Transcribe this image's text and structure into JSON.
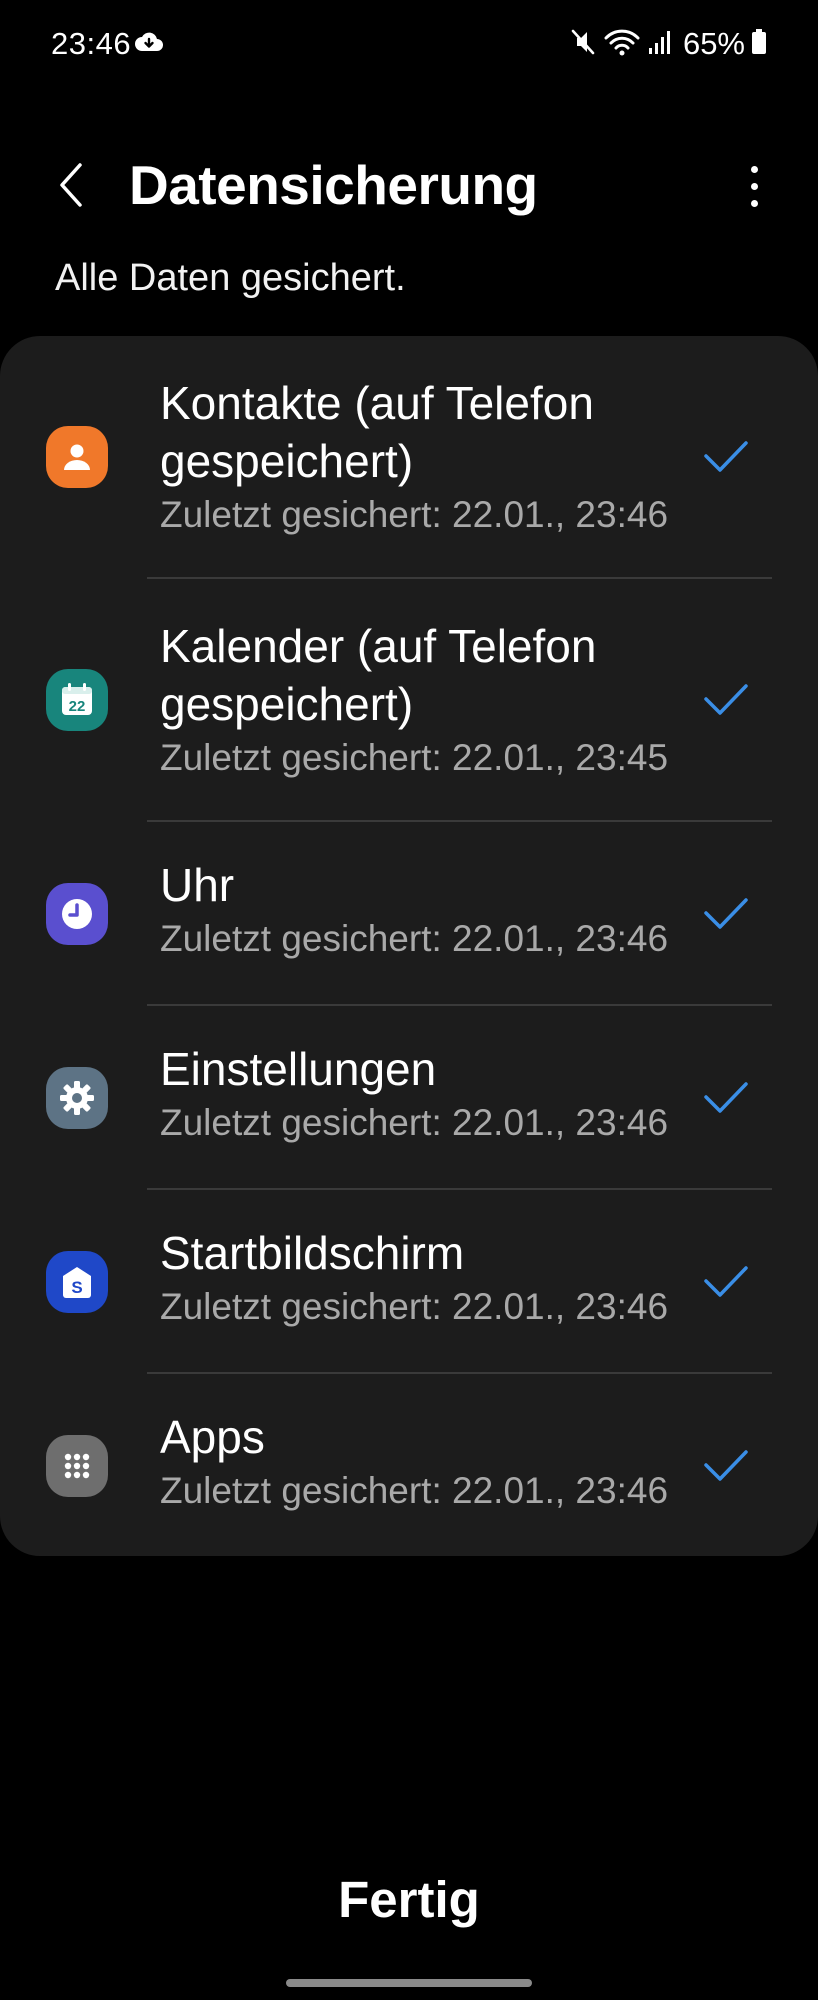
{
  "status_bar": {
    "time": "23:46",
    "battery": "65%",
    "icons": [
      "cloud-sync-icon",
      "mute-icon",
      "wifi-icon",
      "signal-icon",
      "battery-icon"
    ]
  },
  "header": {
    "title": "Datensicherung",
    "back_icon": "chevron-left-icon",
    "more_icon": "more-vertical-icon"
  },
  "subtitle": "Alle Daten gesichert.",
  "items": [
    {
      "title": "Kontakte (auf Telefon gespeichert)",
      "subtitle": "Zuletzt gesichert: 22.01., 23:46",
      "icon": "contacts-icon",
      "color": "#f0782a",
      "checked": true
    },
    {
      "title": "Kalender (auf Telefon gespeichert)",
      "subtitle": "Zuletzt gesichert: 22.01., 23:45",
      "icon": "calendar-icon",
      "icon_text": "22",
      "color": "#18857c",
      "checked": true
    },
    {
      "title": "Uhr",
      "subtitle": "Zuletzt gesichert: 22.01., 23:46",
      "icon": "clock-icon",
      "color": "#5a4fcf",
      "checked": true
    },
    {
      "title": "Einstellungen",
      "subtitle": "Zuletzt gesichert: 22.01., 23:46",
      "icon": "settings-gear-icon",
      "color": "#5d7385",
      "checked": true
    },
    {
      "title": "Startbildschirm",
      "subtitle": "Zuletzt gesichert: 22.01., 23:46",
      "icon": "home-screen-icon",
      "color": "#1f48c8",
      "checked": true
    },
    {
      "title": "Apps",
      "subtitle": "Zuletzt gesichert: 22.01., 23:46",
      "icon": "apps-grid-icon",
      "color": "#6e6e6e",
      "checked": true
    }
  ],
  "colors": {
    "check": "#3a8ee6",
    "card_bg": "#1c1c1c",
    "subtitle_text": "#a9a9a9"
  },
  "footer": {
    "done_label": "Fertig"
  }
}
